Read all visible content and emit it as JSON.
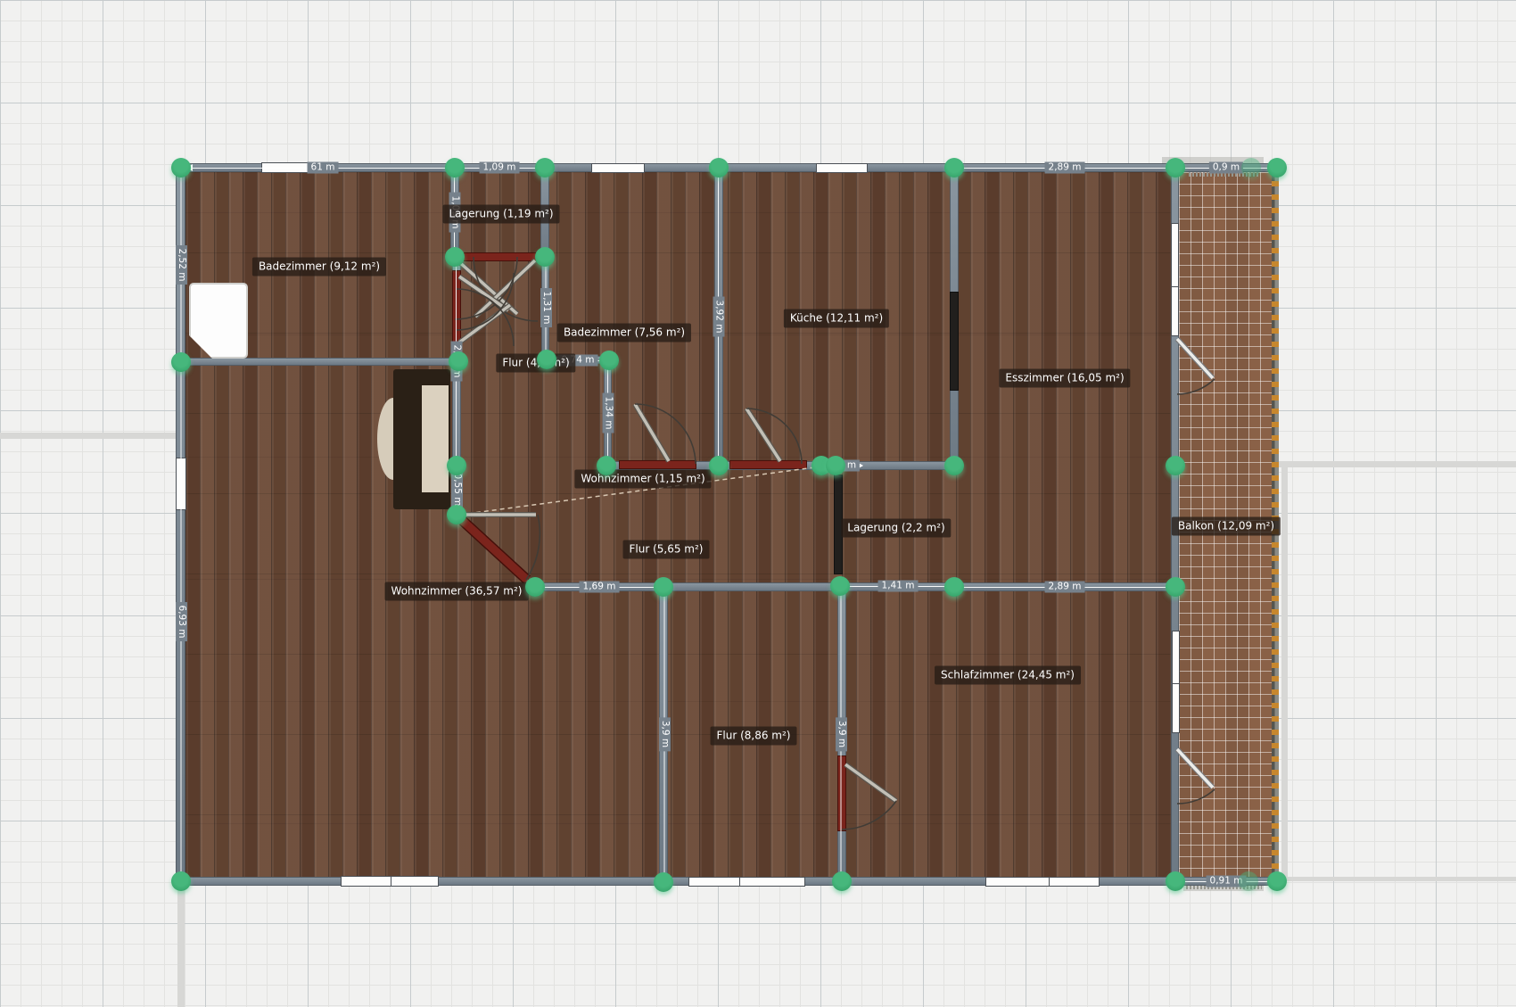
{
  "application": {
    "type": "floorplan-editor-canvas",
    "unit": "m"
  },
  "rooms": {
    "bad1": {
      "label": "Badezimmer (9,12 m²)"
    },
    "lag1": {
      "label": "Lagerung (1,19 m²)"
    },
    "bad2": {
      "label": "Badezimmer (7,56 m²)"
    },
    "flur1": {
      "label": "Flur (4,1 m²)"
    },
    "kueche": {
      "label": "Küche (12,11 m²)"
    },
    "ess": {
      "label": "Esszimmer (16,05 m²)"
    },
    "wohn1": {
      "label": "Wohnzimmer (1,15 m²)"
    },
    "lag2": {
      "label": "Lagerung (2,2 m²)"
    },
    "flur2": {
      "label": "Flur (5,65 m²)"
    },
    "wohn2": {
      "label": "Wohnzimmer (36,57 m²)"
    },
    "balkon": {
      "label": "Balkon (12,09 m²)"
    },
    "schlaf": {
      "label": "Schlafzimmer (24,45 m²)"
    },
    "flur3": {
      "label": "Flur (8,86 m²)"
    }
  },
  "dims": {
    "d1": "61 m",
    "d2": "1,09 m",
    "d3": "2,89 m",
    "d4": "0,9 m",
    "d5": "2,52 m",
    "d6": "1,09 m",
    "d7": "1,31 m",
    "d8": "3,92 m",
    "d9": "2,74 m",
    "d10": "0,74 m",
    "d11": "1,34 m",
    "d12": "0,55 m",
    "d13": "m",
    "d14": "1,69 m",
    "d15": "1,41 m",
    "d16": "2,89 m",
    "d17": "3,9 m",
    "d18": "3,9 m",
    "d19": "6,93 m",
    "d20": "0,91 m"
  },
  "colors": {
    "grid_background": "#f1f1f0",
    "grid_minor_line": "#e2e2e0",
    "grid_major_line": "#c6cbcd",
    "wall_fill": "#77828c",
    "wall_edge": "#545d66",
    "vertex_green": "#36a169",
    "door_maroon": "#7b241c",
    "parquet_wood": "#6b4936",
    "balcony_tile": "#8a6147",
    "railing_dash_orange": "#c7872e",
    "dimension_text": "#ffffff",
    "room_label_text": "#ffffff",
    "room_label_chip": "rgba(38,28,22,0.78)"
  }
}
